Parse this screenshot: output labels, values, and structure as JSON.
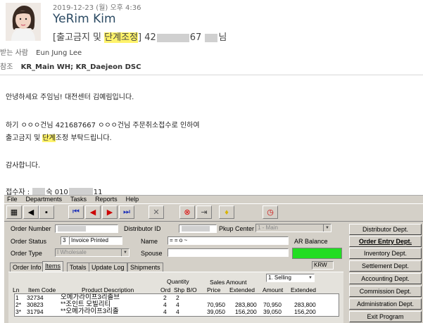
{
  "email": {
    "date": "2019-12-23 (월) 오후 4:36",
    "sender": "YeRim Kim",
    "subject_prefix": "[출고금지 및 ",
    "subject_highlight": "단계조정",
    "subject_suffix1": "] 42",
    "subject_suffix2": "67 ",
    "subject_suffix3": "님",
    "to_label": "받는 사람",
    "to_value": "Eun Jung Lee",
    "cc_label": "참조",
    "cc_value": "KR_Main WH; KR_Daejeon DSC",
    "body": {
      "greeting": "안녕하세요 주임님! 대전센터 김예림입니다.",
      "line2": "하기 ㅇㅇㅇ건님 421687667 ㅇㅇㅇ건님 주문취소접수로 인하여",
      "line3_prefix": "출고금지 및 ",
      "line3_highlight": "단계",
      "line3_suffix": "조정 부탁드립니다.",
      "thanks": "감사합니다.",
      "receiver_prefix": "접수자 : ",
      "receiver_mid": "숙 010",
      "receiver_end": "11"
    }
  },
  "app": {
    "menu": [
      "File",
      "Departments",
      "Tasks",
      "Reports",
      "Help"
    ],
    "toolbar_icons": [
      "grid-icon",
      "back-icon",
      "save-icon",
      "first-icon",
      "prev-icon",
      "next-icon",
      "last-icon",
      "delete-icon",
      "stop-icon",
      "exit-icon",
      "hint-icon",
      "clock-icon"
    ],
    "form": {
      "order_number_label": "Order Number",
      "distributor_id_label": "Distributor ID",
      "pkup_center_label": "Pkup Center",
      "pkup_center_value": "1 - Main",
      "order_status_label": "Order Status",
      "order_status_code": "3",
      "order_status_value": "Invoice Printed",
      "name_label": "Name",
      "name_value": "= = o ~",
      "ar_balance_label": "AR Balance",
      "order_type_label": "Order Type",
      "order_type_value": "I Wholesale",
      "spouse_label": "Spouse",
      "currency": "KRW"
    },
    "tabs": [
      "Order Info",
      "Items",
      "Totals",
      "Update Log",
      "Shipments"
    ],
    "grid": {
      "quantity_label": "Quantity",
      "sales_amount_label": "Sales Amount",
      "selling_select": "1. Selling",
      "headers": {
        "ln": "Ln",
        "item_code": "Item Code",
        "product": "Product Description",
        "ord": "Ord",
        "shp": "Shp",
        "bo": "B/O",
        "price": "Price",
        "extended": "Extended",
        "amount": "Amount",
        "extended2": "Extended"
      },
      "rows": [
        {
          "ln": "1",
          "code": "32734",
          "desc": "오메가라이프3리졸브",
          "ord": "2",
          "shp": "2",
          "bo": "",
          "price": "",
          "ext": "",
          "amount": "",
          "ext2": ""
        },
        {
          "ln": "2*",
          "code": "30823",
          "desc": "**조인트 모빌리티",
          "ord": "4",
          "shp": "4",
          "bo": "",
          "price": "70,950",
          "ext": "283,800",
          "amount": "70,950",
          "ext2": "283,800"
        },
        {
          "ln": "3*",
          "code": "31794",
          "desc": "**오메가라이프3리졸",
          "ord": "4",
          "shp": "4",
          "bo": "",
          "price": "39,050",
          "ext": "156,200",
          "amount": "39,050",
          "ext2": "156,200"
        }
      ]
    },
    "departments": [
      "Distributor Dept.",
      "Order Entry Dept.",
      "Inventory Dept.",
      "Settlement Dept.",
      "Accounting Dept.",
      "Commission Dept.",
      "Administration Dept.",
      "Exit Program"
    ],
    "colors": {
      "ar_balance": "#22dd22",
      "highlight": "#fff36b",
      "sender": "#2b4a63"
    }
  }
}
